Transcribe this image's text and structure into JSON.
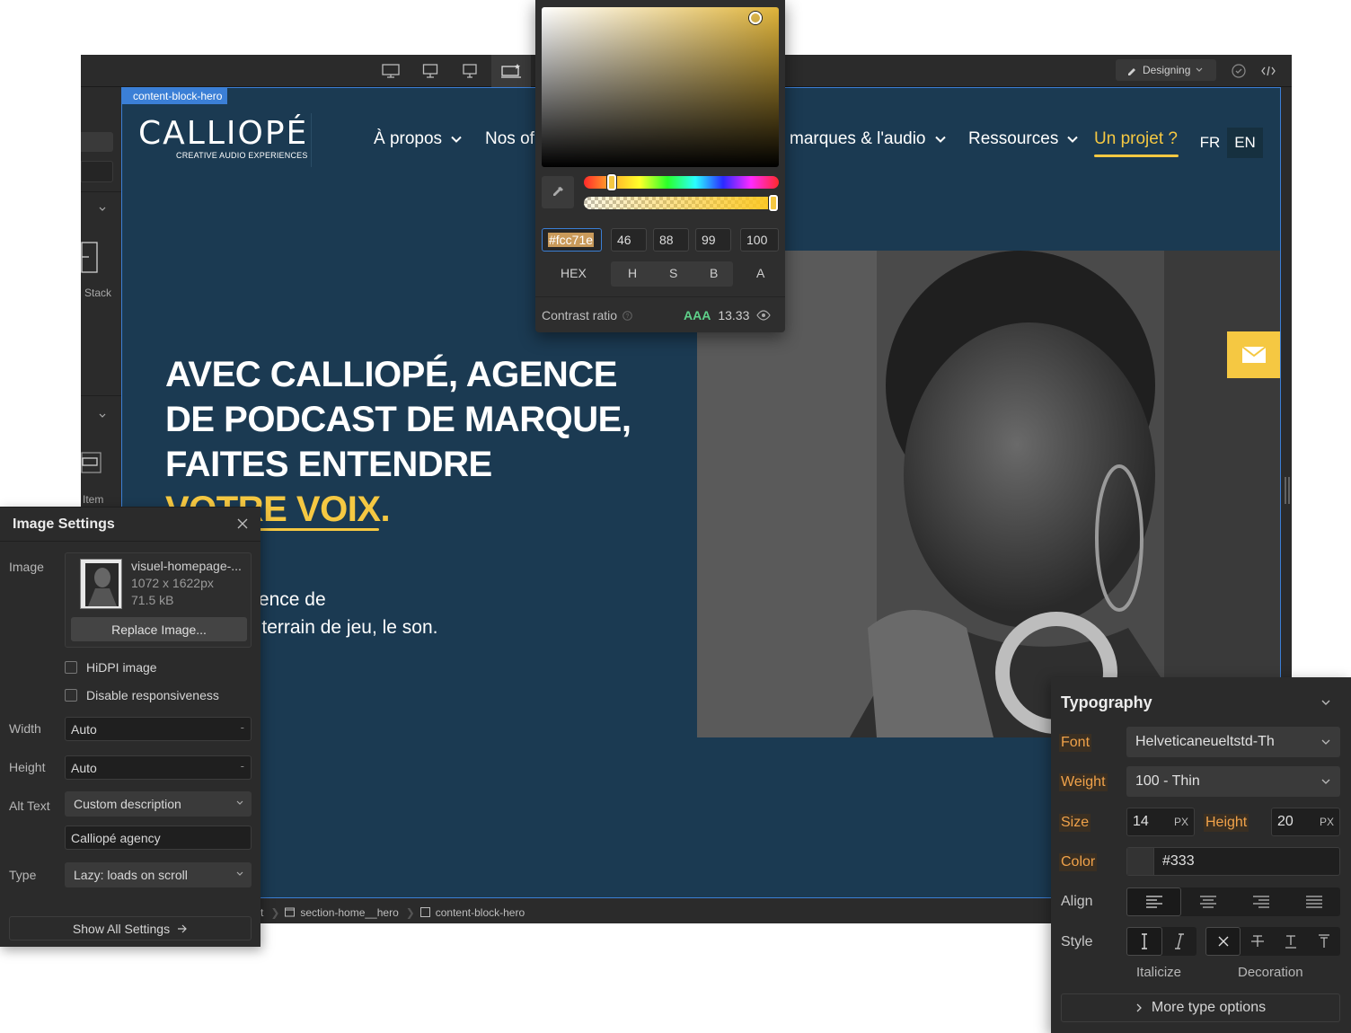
{
  "toolbar": {
    "mode_label": "Designing"
  },
  "left_strip": {
    "stack_label": "Stack",
    "item_label": "Item"
  },
  "canvas": {
    "selected_tag": "content-block-hero",
    "logo": {
      "name": "CALLIOPÉ",
      "tagline": "CREATIVE AUDIO EXPERIENCES"
    },
    "nav": [
      {
        "label": "À propos"
      },
      {
        "label": "Nos of"
      },
      {
        "label": "marques & l'audio"
      },
      {
        "label": "Ressources"
      },
      {
        "label": "Un projet ?"
      }
    ],
    "languages": {
      "fr": "FR",
      "en": "EN"
    },
    "hero": {
      "title_lines": [
        "AVEC CALLIOPÉ, AGENCE",
        "DE PODCAST DE MARQUE,",
        "FAITES ENTENDRE"
      ],
      "title_accent": "VOTRE VOIX.",
      "body_line_1": "nes une agence de",
      "body_line_2": "ition. Notre terrain de jeu, le son."
    },
    "accent_color": "#f5c842",
    "background_color": "#1b3a52"
  },
  "breadcrumb": {
    "items": [
      "t",
      "section-home__hero",
      "content-block-hero"
    ]
  },
  "color_picker": {
    "hex": "#fcc71e",
    "h": "46",
    "s": "88",
    "b": "99",
    "a": "100",
    "labels": {
      "hex": "HEX",
      "h": "H",
      "s": "S",
      "b": "B",
      "a": "A"
    },
    "contrast_label": "Contrast ratio",
    "contrast_grade": "AAA",
    "contrast_value": "13.33"
  },
  "image_settings": {
    "title": "Image Settings",
    "image_label": "Image",
    "file_name": "visuel-homepage-...",
    "dimensions": "1072 x 1622px",
    "file_size": "71.5 kB",
    "replace_label": "Replace Image...",
    "hidpi_label": "HiDPI image",
    "hidpi_checked": false,
    "disable_resp_label": "Disable responsiveness",
    "disable_resp_checked": false,
    "width_label": "Width",
    "width_value": "Auto",
    "height_label": "Height",
    "height_value": "Auto",
    "alt_label": "Alt Text",
    "alt_mode": "Custom description",
    "alt_value": "Calliopé agency",
    "type_label": "Type",
    "type_value": "Lazy: loads on scroll",
    "show_all_label": "Show All Settings"
  },
  "typography": {
    "title": "Typography",
    "font_label": "Font",
    "font_value": "Helveticaneueltstd-Th",
    "weight_label": "Weight",
    "weight_value": "100 - Thin",
    "size_label": "Size",
    "size_value": "14",
    "size_unit": "PX",
    "height_label": "Height",
    "height_value": "20",
    "height_unit": "PX",
    "color_label": "Color",
    "color_value": "#333",
    "align_label": "Align",
    "style_label": "Style",
    "italicize_label": "Italicize",
    "decoration_label": "Decoration",
    "more_label": "More type options"
  }
}
